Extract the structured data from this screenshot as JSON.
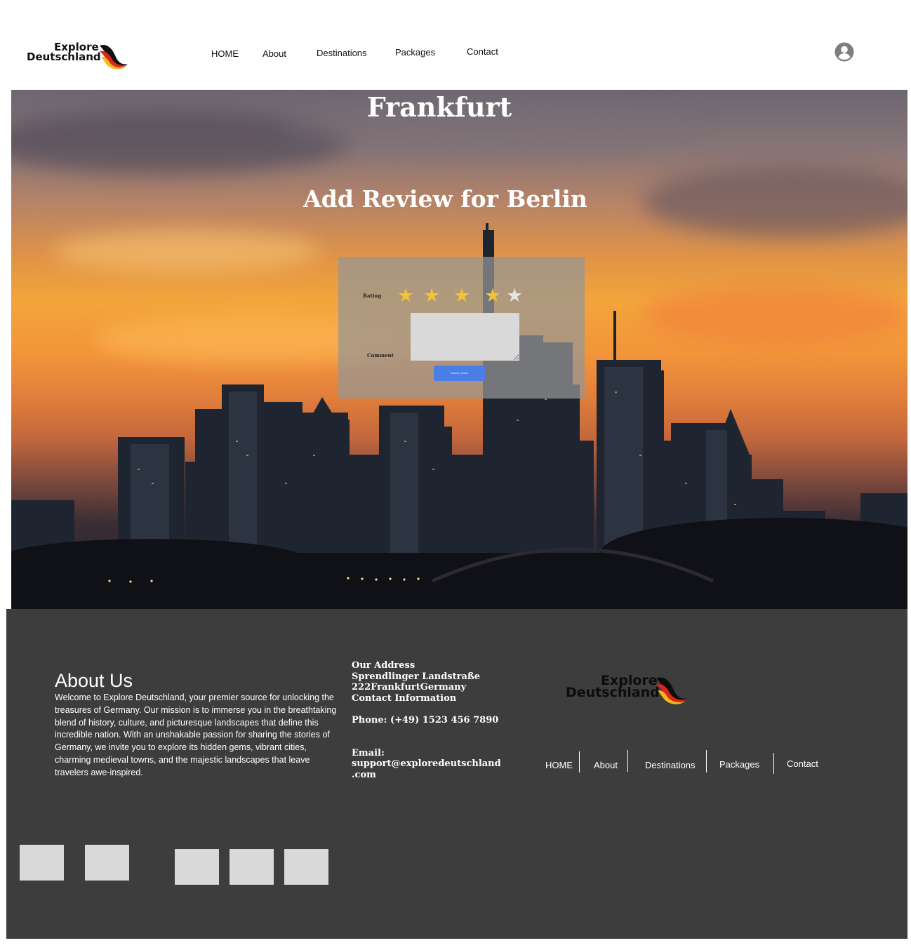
{
  "header": {
    "logo": {
      "line1": "Explore",
      "line2": "Deutschland"
    },
    "nav": [
      "HOME",
      "About",
      "Destinations",
      "Packages",
      "Contact"
    ],
    "user_icon": "user-circle-icon"
  },
  "hero": {
    "city_title": "Frankfurt",
    "review_title": "Add Review for Berlin",
    "form": {
      "rating_label": "Rating",
      "rating": 4,
      "rating_max": 5,
      "comment_label": "Comment",
      "comment_value": "",
      "submit_label": "Submit review"
    }
  },
  "footer": {
    "about_title": "About Us",
    "about_text": "Welcome to Explore Deutschland, your premier source for unlocking the treasures of Germany. Our mission is to immerse you in the breathtaking blend of history, culture, and picturesque landscapes that define this incredible nation. With an unshakable passion for sharing the stories of Germany, we invite you to explore its hidden gems, vibrant cities, charming medieval towns, and the majestic landscapes that leave travelers awe-inspired.",
    "address_heading": "Our Address",
    "address_line1": "Sprendlinger Landstraße",
    "address_line2": "222FrankfurtGermany",
    "contact_heading": "Contact Information",
    "phone": "Phone: (+49) 1523 456 7890",
    "email_label": "Email:",
    "email_value": "support@exploredeutschland\n.com",
    "logo": {
      "line1": "Explore",
      "line2": "Deutschland"
    },
    "nav": [
      "HOME",
      "About",
      "Destinations",
      "Packages",
      "Contact"
    ],
    "social_placeholders": 5
  },
  "colors": {
    "footer_bg": "#3d3d3d",
    "submit_button": "#4a7ee6",
    "star_filled": "#f2c23a",
    "star_empty": "#e4e4e4",
    "placeholder_gray": "#d9d9d9"
  }
}
